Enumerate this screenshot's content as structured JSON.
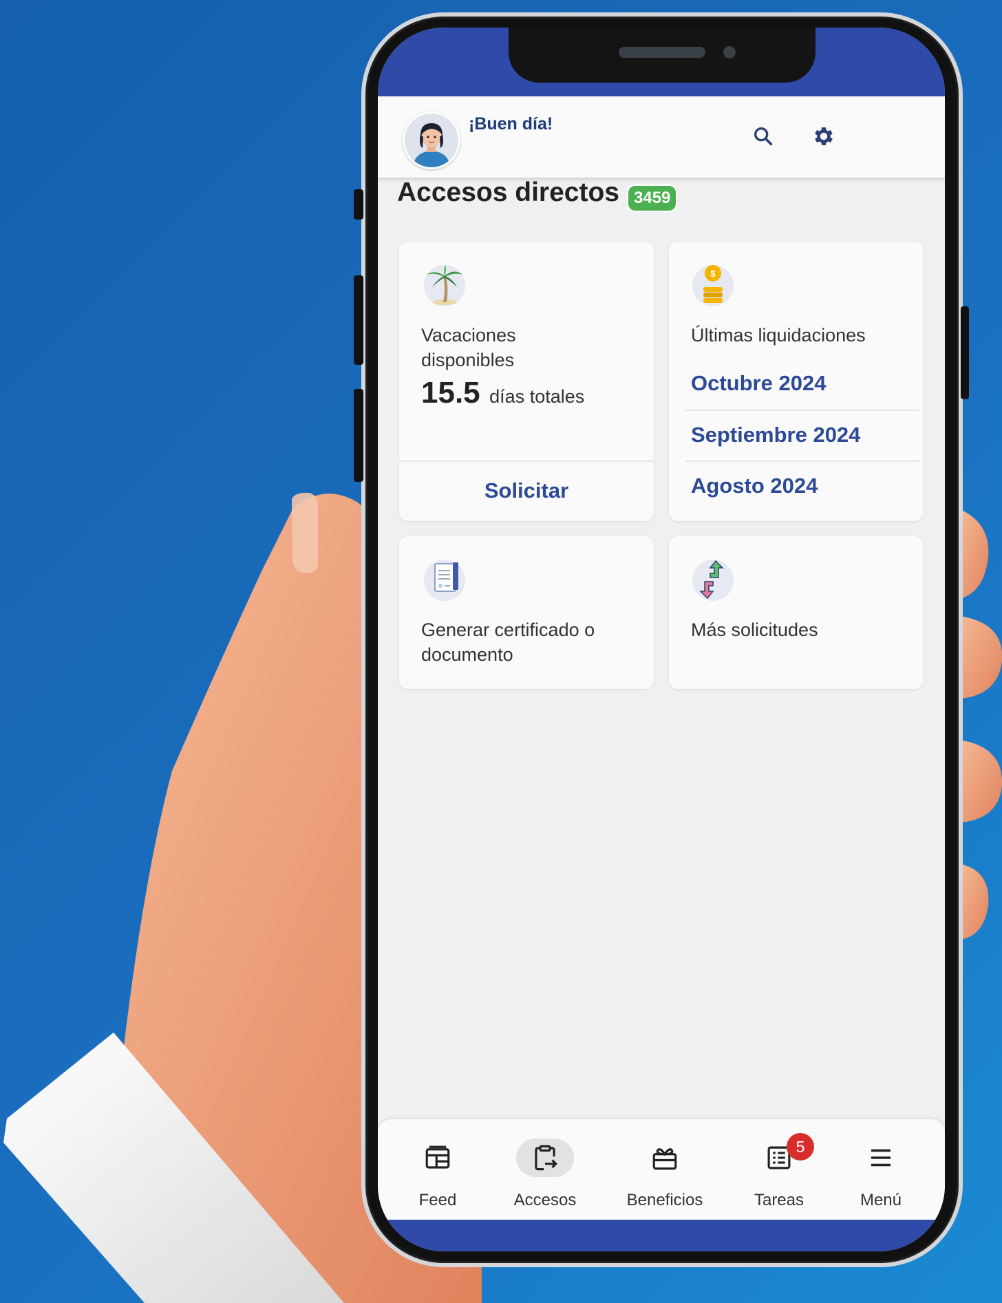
{
  "header": {
    "greeting": "¡Buen día!"
  },
  "section": {
    "title": "Accesos directos",
    "badge": "3459"
  },
  "cards": {
    "vacaciones": {
      "label": "Vacaciones disponibles",
      "value": "15.5",
      "unit": "días totales",
      "action": "Solicitar"
    },
    "liquidaciones": {
      "label": "Últimas liquidaciones",
      "items": [
        "Octubre 2024",
        "Septiembre 2024",
        "Agosto 2024"
      ]
    },
    "certificado": {
      "label": "Generar certificado o documento"
    },
    "solicitudes": {
      "label": "Más solicitudes"
    }
  },
  "nav": {
    "items": [
      {
        "label": "Feed",
        "icon": "feed-icon"
      },
      {
        "label": "Accesos",
        "icon": "accesos-icon",
        "active": true
      },
      {
        "label": "Beneficios",
        "icon": "gift-icon"
      },
      {
        "label": "Tareas",
        "icon": "tasks-icon",
        "badge": "5"
      },
      {
        "label": "Menú",
        "icon": "menu-icon"
      }
    ]
  },
  "colors": {
    "background": "#1a6fbf",
    "brand_blue": "#2f4aa8",
    "link_blue": "#2d4a96",
    "badge_green": "#4caf50",
    "badge_red": "#d92d2d"
  }
}
